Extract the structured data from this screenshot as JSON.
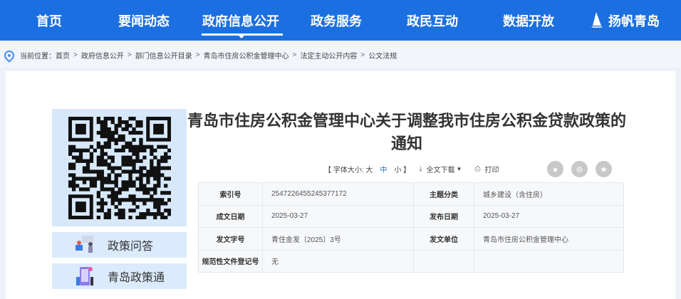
{
  "nav": {
    "items": [
      "首页",
      "要闻动态",
      "政府信息公开",
      "政务服务",
      "政民互动",
      "数据开放",
      "扬帆青岛"
    ],
    "active": "政府信息公开"
  },
  "breadcrumb": {
    "prefix": "当前位置：",
    "items": [
      "首页",
      "政府信息公开",
      "部门信息公开目录",
      "青岛市住房公积金管理中心",
      "法定主动公开内容",
      "公文法规"
    ]
  },
  "sidebar": {
    "buttons": [
      "政策问答",
      "青岛政策通"
    ]
  },
  "article": {
    "title": "青岛市住房公积金管理中心关于调整我市住房公积金贷款政策的通知"
  },
  "toolbar": {
    "font_size_label": "【 字体大小: 大",
    "font_mid": "中",
    "font_small": "小 】",
    "download": "全文下载",
    "print": "打印"
  },
  "meta": {
    "rows": [
      {
        "l1": "索引号",
        "v1": "2547226455245377172",
        "l2": "主题分类",
        "v2": "城乡建设（含住房）"
      },
      {
        "l1": "成文日期",
        "v1": "2025-03-27",
        "l2": "发布日期",
        "v2": "2025-03-27"
      },
      {
        "l1": "发文字号",
        "v1": "青住金发〔2025〕3号",
        "l2": "发文单位",
        "v2": "青岛市住房公积金管理中心"
      },
      {
        "l1": "规范性文件登记号",
        "v1": "无",
        "l2": "",
        "v2": ""
      }
    ]
  },
  "colors": {
    "nav": "#1b6fe0",
    "accent": "#1b6fe0"
  }
}
